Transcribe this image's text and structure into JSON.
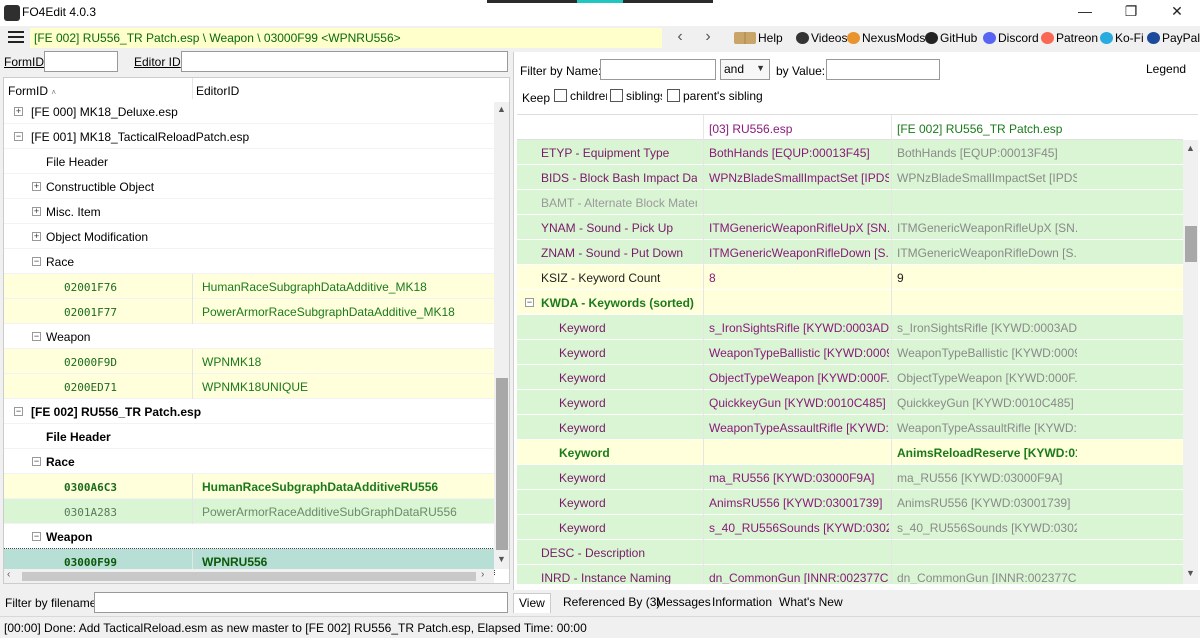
{
  "window": {
    "title": "FO4Edit 4.0.3",
    "min": "—",
    "max": "❐",
    "close": "✕"
  },
  "toolbar": {
    "record_path": "[FE 002] RU556_TR Patch.esp \\ Weapon \\ 03000F99 <WPNRU556>",
    "back": "‹",
    "forward": "›",
    "links": [
      {
        "label": "Help",
        "icon": "book-icon"
      },
      {
        "label": "Videos",
        "icon": "film-icon"
      },
      {
        "label": "NexusMods",
        "icon": "nexus-icon"
      },
      {
        "label": "GitHub",
        "icon": "github-icon"
      },
      {
        "label": "Discord",
        "icon": "discord-icon"
      },
      {
        "label": "Patreon",
        "icon": "patreon-icon"
      },
      {
        "label": "Ko-Fi",
        "icon": "kofi-icon"
      },
      {
        "label": "PayPal",
        "icon": "paypal-icon"
      }
    ]
  },
  "left": {
    "formid_label": "FormID",
    "editorid_label": "Editor ID",
    "col_formid": "FormID",
    "col_editorid": "EditorID",
    "filter_label": "Filter by filename:",
    "rows": [
      {
        "indent": 0,
        "exp": "+",
        "label": "[FE 000] MK18_Deluxe.esp",
        "bg": "#ffffff"
      },
      {
        "indent": 0,
        "exp": "−",
        "label": "[FE 001] MK18_TacticalReloadPatch.esp",
        "bg": "#ffffff"
      },
      {
        "indent": 1,
        "exp": "",
        "label": "File Header",
        "bg": "#ffffff"
      },
      {
        "indent": 1,
        "exp": "+",
        "label": "Constructible Object",
        "bg": "#ffffff"
      },
      {
        "indent": 1,
        "exp": "+",
        "label": "Misc. Item",
        "bg": "#ffffff"
      },
      {
        "indent": 1,
        "exp": "+",
        "label": "Object Modification",
        "bg": "#ffffff"
      },
      {
        "indent": 1,
        "exp": "−",
        "label": "Race",
        "bg": "#ffffff"
      },
      {
        "indent": 2,
        "formid": "02001F76",
        "editorid": "HumanRaceSubgraphDataAdditive_MK18",
        "bg": "#ffffdc"
      },
      {
        "indent": 2,
        "formid": "02001F77",
        "editorid": "PowerArmorRaceSubgraphDataAdditive_MK18",
        "bg": "#ffffdc"
      },
      {
        "indent": 1,
        "exp": "−",
        "label": "Weapon",
        "bg": "#ffffff"
      },
      {
        "indent": 2,
        "formid": "02000F9D",
        "editorid": "WPNMK18",
        "bg": "#ffffdc"
      },
      {
        "indent": 2,
        "formid": "0200ED71",
        "editorid": "WPNMK18UNIQUE",
        "bg": "#ffffdc"
      },
      {
        "indent": 0,
        "exp": "−",
        "label": "[FE 002] RU556_TR Patch.esp",
        "bg": "#ffffff",
        "bold": true
      },
      {
        "indent": 1,
        "exp": "",
        "label": "File Header",
        "bg": "#ffffff",
        "bold": true
      },
      {
        "indent": 1,
        "exp": "−",
        "label": "Race",
        "bg": "#ffffff",
        "bold": true
      },
      {
        "indent": 2,
        "formid": "0300A6C3",
        "editorid": "HumanRaceSubgraphDataAdditiveRU556",
        "bg": "#ffffdc",
        "bold": true
      },
      {
        "indent": 2,
        "formid": "0301A283",
        "editorid": "PowerArmorRaceAdditiveSubGraphDataRU556",
        "bg": "#d9f5d3",
        "grey": true
      },
      {
        "indent": 1,
        "exp": "−",
        "label": "Weapon",
        "bg": "#ffffff",
        "bold": true
      },
      {
        "indent": 2,
        "formid": "03000F99",
        "editorid": "WPNRU556",
        "bg": "#b8dfd5",
        "bold": true,
        "selected": true
      }
    ]
  },
  "right": {
    "filter_name_label": "Filter by Name:",
    "and_value": "and",
    "by_value_label": "by Value:",
    "legend": "Legend",
    "keep": "Keep",
    "checks": [
      "children",
      "siblings",
      "parent's sibling"
    ],
    "col1": "[03] RU556.esp",
    "col2": "[FE 002] RU556_TR Patch.esp",
    "rows": [
      {
        "indent": 0,
        "name": "ETYP - Equipment Type",
        "v1": "BothHands [EQUP:00013F45]",
        "v2": "BothHands [EQUP:00013F45]",
        "bg": "g-green"
      },
      {
        "indent": 0,
        "name": "BIDS - Block Bash Impact Dat...",
        "v1": "WPNzBladeSmallImpactSet [IPDS:...",
        "v2": "WPNzBladeSmallImpactSet [IPDS:...",
        "bg": "g-green"
      },
      {
        "indent": 0,
        "name": "BAMT - Alternate Block Material",
        "v1": "",
        "v2": "",
        "bg": "g-green",
        "dim": true
      },
      {
        "indent": 0,
        "name": "YNAM - Sound - Pick Up",
        "v1": "ITMGenericWeaponRifleUpX [SN...",
        "v2": "ITMGenericWeaponRifleUpX [SN...",
        "bg": "g-green"
      },
      {
        "indent": 0,
        "name": "ZNAM - Sound - Put Down",
        "v1": "ITMGenericWeaponRifleDown [S...",
        "v2": "ITMGenericWeaponRifleDown [S...",
        "bg": "g-green"
      },
      {
        "indent": 0,
        "name": "KSIZ - Keyword Count",
        "v1": "8",
        "v2": "9",
        "bg": "g-yellow",
        "dark": true
      },
      {
        "indent": 0,
        "name": "KWDA - Keywords (sorted)",
        "v1": "",
        "v2": "",
        "bg": "g-yellow",
        "exp": "−",
        "boldgreen": true
      },
      {
        "indent": 1,
        "name": "Keyword",
        "v1": "s_IronSightsRifle [KYWD:0003AD...",
        "v2": "s_IronSightsRifle [KYWD:0003AD...",
        "bg": "g-green"
      },
      {
        "indent": 1,
        "name": "Keyword",
        "v1": "WeaponTypeBallistic [KYWD:0009...",
        "v2": "WeaponTypeBallistic [KYWD:0009...",
        "bg": "g-green"
      },
      {
        "indent": 1,
        "name": "Keyword",
        "v1": "ObjectTypeWeapon [KYWD:000F...",
        "v2": "ObjectTypeWeapon [KYWD:000F...",
        "bg": "g-green"
      },
      {
        "indent": 1,
        "name": "Keyword",
        "v1": "QuickkeyGun [KYWD:0010C485]",
        "v2": "QuickkeyGun [KYWD:0010C485]",
        "bg": "g-green"
      },
      {
        "indent": 1,
        "name": "Keyword",
        "v1": "WeaponTypeAssaultRifle [KYWD:...",
        "v2": "WeaponTypeAssaultRifle [KYWD:...",
        "bg": "g-green"
      },
      {
        "indent": 1,
        "name": "Keyword",
        "v1": "",
        "v2": "AnimsReloadReserve [KYWD:01...",
        "bg": "g-yellow",
        "added": true
      },
      {
        "indent": 1,
        "name": "Keyword",
        "v1": "ma_RU556 [KYWD:03000F9A]",
        "v2": "ma_RU556 [KYWD:03000F9A]",
        "bg": "g-green"
      },
      {
        "indent": 1,
        "name": "Keyword",
        "v1": "AnimsRU556 [KYWD:03001739]",
        "v2": "AnimsRU556 [KYWD:03001739]",
        "bg": "g-green"
      },
      {
        "indent": 1,
        "name": "Keyword",
        "v1": "s_40_RU556Sounds [KYWD:0302...",
        "v2": "s_40_RU556Sounds [KYWD:0302...",
        "bg": "g-green"
      },
      {
        "indent": 0,
        "name": "DESC - Description",
        "v1": "",
        "v2": "",
        "bg": "g-green"
      },
      {
        "indent": 0,
        "name": "INRD - Instance Naming",
        "v1": "dn_CommonGun [INNR:002377CF]",
        "v2": "dn_CommonGun [INNR:002377CF]",
        "bg": "g-green"
      }
    ],
    "tabs": [
      "View",
      "Referenced By (3)",
      "Messages",
      "Information",
      "What's New"
    ]
  },
  "status": "[00:00] Done: Add TacticalReload.esm as new master to [FE 002] RU556_TR Patch.esp, Elapsed Time: 00:00"
}
